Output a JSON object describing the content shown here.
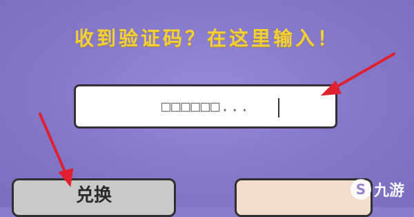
{
  "prompt": {
    "text": "收到验证码？在这里输入！"
  },
  "code_input": {
    "value": "",
    "placeholder": "□□□□□□..."
  },
  "buttons": {
    "redeem_label": "兑换"
  },
  "watermark": {
    "text": "九游",
    "logo": "S"
  },
  "colors": {
    "background": "#8a7ccd",
    "prompt": "#f3cf3a",
    "arrow": "#e02030"
  }
}
